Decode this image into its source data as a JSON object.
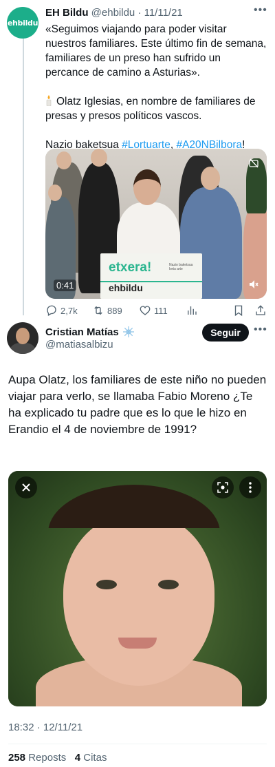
{
  "tweet1": {
    "avatar_text": "ehbildu",
    "name": "EH Bildu",
    "handle": "@ehbildu",
    "date": "· 11/11/21",
    "paragraphs": [
      "«Seguimos viajando para poder visitar nuestros familiares. Este último fin de semana, familiares de un preso han sufrido un percance de camino a Asturias».",
      "Olatz Iglesias, en nombre de familiares de presas y presos políticos vascos."
    ],
    "hashtag_line_prefix": "Nazio baketsua ",
    "hashtag1": "#Lortuarte",
    "hashtag_sep": ", ",
    "hashtag2": "#A20NBilbora",
    "hashtag_suffix": "!",
    "video": {
      "duration": "0:41",
      "podium_logo": "etxera!",
      "podium_small": "Nazio baketsua lortu arte",
      "bottom_logo": "ehbildu"
    },
    "actions": {
      "replies": "2,7k",
      "reposts": "889",
      "likes": "111"
    },
    "icons": [
      "reply-icon",
      "repost-icon",
      "like-icon",
      "views-icon",
      "bookmark-icon",
      "share-icon"
    ]
  },
  "tweet2": {
    "name": "Cristian Matías",
    "handle": "@matiasalbizu",
    "follow_label": "Seguir",
    "text": "Aupa Olatz, los familiares de este niño no pueden viajar para verlo, se llamaba Fabio Moreno ¿Te ha explicado tu padre que es lo que le hizo en Erandio el 4 de noviembre de 1991?",
    "time": "18:32 · 12/11/21",
    "reposts_count": "258",
    "reposts_label": "Reposts",
    "quotes_count": "4",
    "quotes_label": "Citas"
  },
  "colors": {
    "link": "#1d9bf0",
    "secondary_text": "#536471",
    "brand_green": "#1cae8a"
  }
}
